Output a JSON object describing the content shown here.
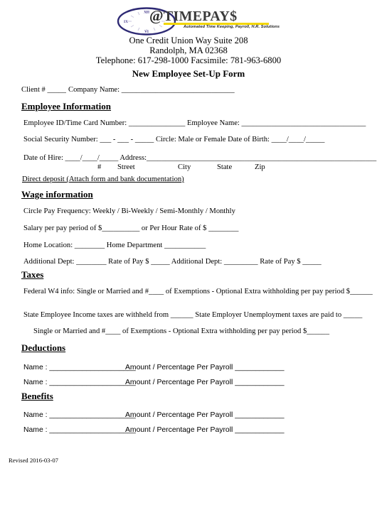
{
  "logo": {
    "brand_at": "@",
    "brand_time": "TIME",
    "brand_pay": "PAY$",
    "tagline": "Automated Time Keeping, Payroll, H.R. Solutions",
    "roman_xii": "XII",
    "roman_ix": "IX",
    "roman_vi": "VI",
    "ellipse_color": "#2e2a74",
    "accent_color": "#f2d600",
    "numeral_color": "#4a3f8f",
    "text_color": "#3b3b3b"
  },
  "header": {
    "address_line1": "One Credit Union Way Suite 208",
    "address_line2": "Randolph, MA 02368",
    "contact_line": "Telephone: 617-298-1000     Facsimile: 781-963-6800"
  },
  "title": "New Employee Set-Up Form",
  "client_row": {
    "client_label": "Client #  _____",
    "company_label": "Company Name:  ______________________________"
  },
  "sections": {
    "employee_information": "Employee Information",
    "wage_information": "Wage information",
    "taxes": "Taxes",
    "deductions": "Deductions",
    "benefits": "Benefits"
  },
  "employee": {
    "id_line": "Employee ID/Time Card  Number:  _______________          Employee Name:  _________________________________",
    "ssn_line": "Social Security Number:  ___ - ___ - _____                Circle:  Male or Female     Date of Birth:  ____/____/_____",
    "hire_line": "Date of Hire:  ____/____/_____          Address:_____________________________________________________________",
    "sub_hash": "#",
    "sub_street": "Street",
    "sub_city": "City",
    "sub_state": "State",
    "sub_zip": "Zip",
    "direct_deposit": "Direct deposit (Attach form and bank documentation)"
  },
  "wage": {
    "frequency_line": "Circle Pay Frequency: Weekly / Bi-Weekly / Semi-Monthly / Monthly",
    "salary_line": "Salary per pay period of  $__________   or Per Hour Rate of $ ________",
    "home_line": "Home Location: ________  Home Department ___________",
    "additional_line": "Additional Dept: ________  Rate of Pay $ _____    Additional Dept: _________  Rate of Pay $ _____"
  },
  "taxes": {
    "federal_line": "Federal W4 info:   Single or Married  and   #____ of Exemptions   - Optional Extra withholding per pay period $______",
    "state_line": "State Employee Income taxes are withheld from ______          State Employer Unemployment taxes are paid to _____",
    "state_sub_line": "Single or Married and  #____ of Exemptions   -  Optional Extra withholding per pay period $______"
  },
  "deductions": {
    "rows": [
      {
        "name_label": "Name : _____________________",
        "amount_label": "Amount / Percentage Per Payroll ____________"
      },
      {
        "name_label": "Name : _____________________",
        "amount_label": "Amount / Percentage Per Payroll ____________"
      }
    ]
  },
  "benefits": {
    "rows": [
      {
        "name_label": "Name : _____________________",
        "amount_label": "Amount / Percentage Per Payroll ____________"
      },
      {
        "name_label": "Name : _____________________",
        "amount_label": "Amount / Percentage Per Payroll ____________"
      }
    ]
  },
  "footer": {
    "revised": "Revised 2016-03-07"
  }
}
